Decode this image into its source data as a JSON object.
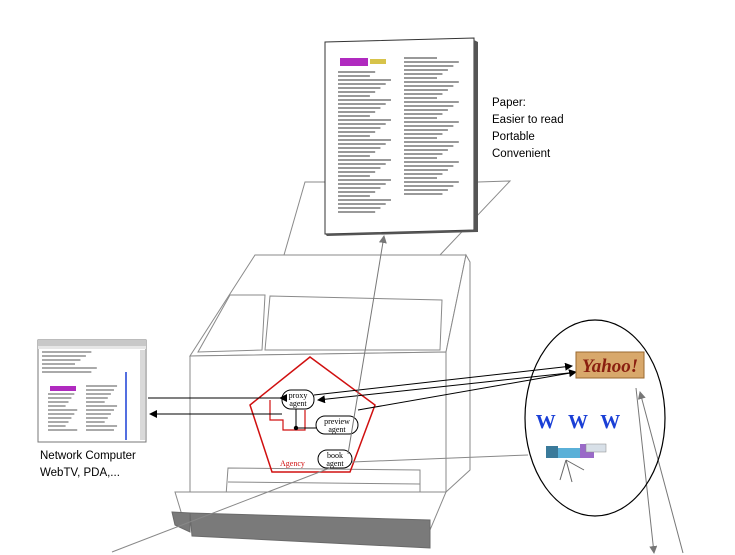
{
  "paper": {
    "title": "Paper:",
    "lines": [
      "Easier to read",
      "Portable",
      "Convenient"
    ]
  },
  "network": {
    "line1": "Network Computer",
    "line2": "WebTV, PDA,..."
  },
  "agency": {
    "label": "Agency",
    "proxy": [
      "proxy",
      "agent"
    ],
    "preview": [
      "preview",
      "agent"
    ],
    "book": [
      "book",
      "agent"
    ]
  },
  "web": {
    "www": "W W W",
    "logo": "Yahoo!"
  },
  "colors": {
    "agency_red": "#d01010",
    "www_blue": "#1a3fd6",
    "line_gray": "#8a8a8a"
  }
}
